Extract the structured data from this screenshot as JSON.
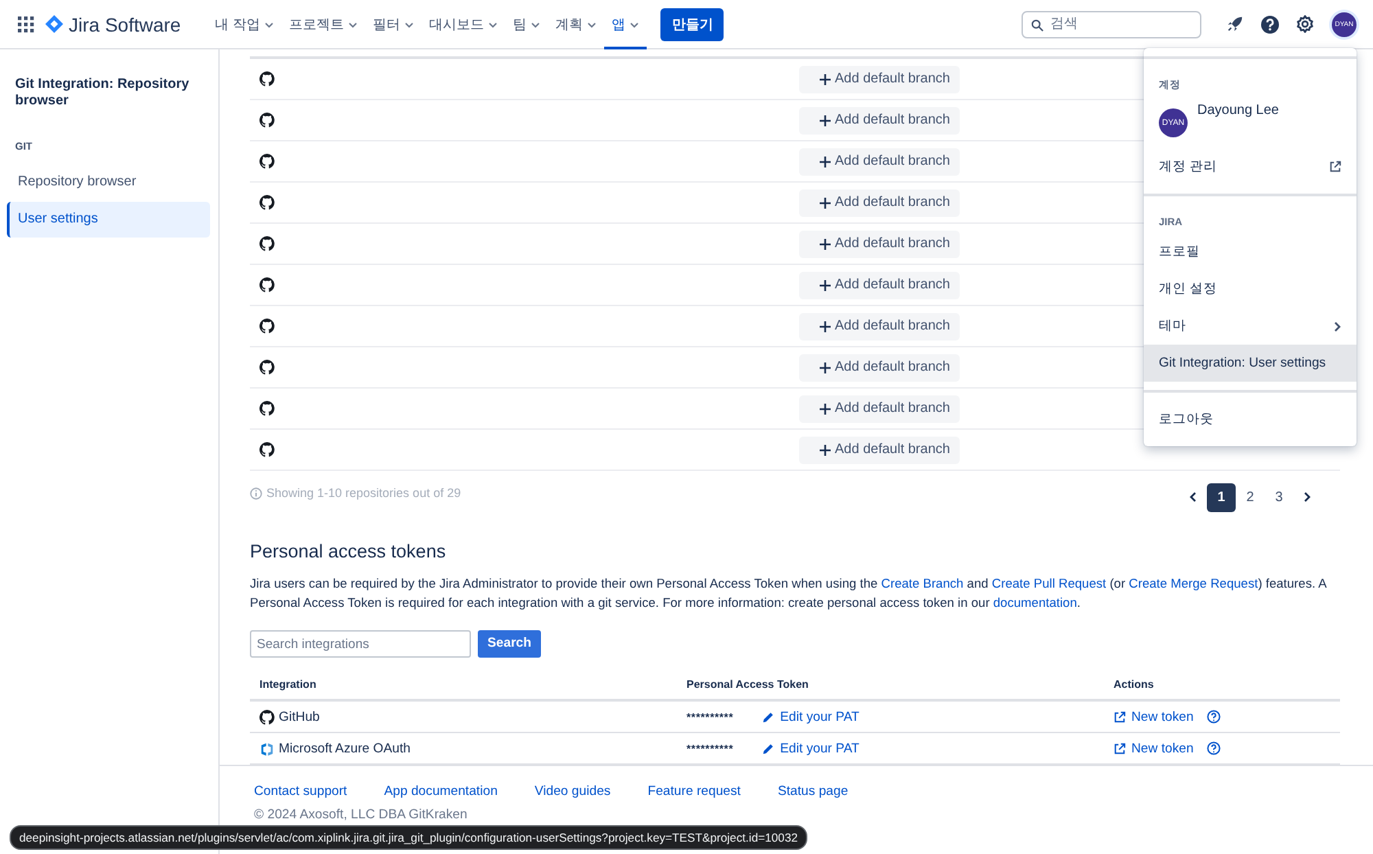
{
  "header": {
    "product": "Jira Software",
    "nav": [
      {
        "label": "내 작업",
        "selected": false
      },
      {
        "label": "프로젝트",
        "selected": false
      },
      {
        "label": "필터",
        "selected": false
      },
      {
        "label": "대시보드",
        "selected": false
      },
      {
        "label": "팀",
        "selected": false
      },
      {
        "label": "계획",
        "selected": false
      },
      {
        "label": "앱",
        "selected": true
      }
    ],
    "create_button": "만들기",
    "search": {
      "placeholder": "검색"
    },
    "avatar": "DYAN"
  },
  "sidebar": {
    "title": "Git Integration: Repository browser",
    "section": "GIT",
    "items": [
      {
        "label": "Repository browser",
        "selected": false
      },
      {
        "label": "User settings",
        "selected": true
      }
    ]
  },
  "repositories": {
    "rows": [
      {
        "button": "Add default branch"
      },
      {
        "button": "Add default branch"
      },
      {
        "button": "Add default branch"
      },
      {
        "button": "Add default branch"
      },
      {
        "button": "Add default branch"
      },
      {
        "button": "Add default branch"
      },
      {
        "button": "Add default branch"
      },
      {
        "button": "Add default branch"
      },
      {
        "button": "Add default branch"
      },
      {
        "button": "Add default branch"
      }
    ],
    "summary": "Showing 1-10 repositories out of 29",
    "pages": [
      {
        "label": "1",
        "selected": true
      },
      {
        "label": "2",
        "selected": false
      },
      {
        "label": "3",
        "selected": false
      }
    ]
  },
  "tokens": {
    "title": "Personal access tokens",
    "description": [
      {
        "kind": "text",
        "text": "Jira users can be required by the Jira Administrator to provide their own Personal Access Token when using the "
      },
      {
        "kind": "link",
        "text": "Create Branch"
      },
      {
        "kind": "text",
        "text": " and "
      },
      {
        "kind": "link",
        "text": "Create Pull Request"
      },
      {
        "kind": "text",
        "text": " (or "
      },
      {
        "kind": "link",
        "text": "Create Merge Request"
      },
      {
        "kind": "text",
        "text": ") features. A Personal Access Token is required for each integration with a git service. For more information: create personal access token in our "
      },
      {
        "kind": "link",
        "text": "documentation"
      },
      {
        "kind": "text",
        "text": "."
      }
    ],
    "search": {
      "placeholder": "Search integrations"
    },
    "search_button": "Search",
    "columns": [
      "Integration",
      "Personal Access Token",
      "Actions"
    ],
    "rows": [
      {
        "kind": "github",
        "integration": "GitHub",
        "token": "**********",
        "edit": "Edit your PAT",
        "new_token": "New token"
      },
      {
        "kind": "azure",
        "integration": "Microsoft Azure OAuth",
        "token": "**********",
        "edit": "Edit your PAT",
        "new_token": "New token"
      }
    ]
  },
  "footer": {
    "links": [
      "Contact support",
      "App documentation",
      "Video guides",
      "Feature request",
      "Status page"
    ],
    "copyright": "© 2024 Axosoft, LLC DBA GitKraken"
  },
  "account_menu": {
    "sections": [
      {
        "heading": "계정",
        "user": {
          "avatar": "DYAN",
          "name": "Dayoung Lee"
        },
        "items": [
          {
            "label": "계정 관리",
            "kind": "external",
            "selected": false
          }
        ]
      },
      {
        "heading": "JIRA",
        "items": [
          {
            "label": "프로필",
            "kind": "plain",
            "selected": false
          },
          {
            "label": "개인 설정",
            "kind": "plain",
            "selected": false
          },
          {
            "label": "테마",
            "kind": "submenu",
            "selected": false
          },
          {
            "label": "Git Integration: User settings",
            "kind": "plain",
            "selected": true
          }
        ]
      },
      {
        "items": [
          {
            "label": "로그아웃",
            "kind": "plain",
            "selected": false
          }
        ]
      }
    ]
  },
  "status_url": "deepinsight-projects.atlassian.net/plugins/servlet/ac/com.xiplink.jira.git.jira_git_plugin/configuration-userSettings?project.key=TEST&project.id=10032"
}
